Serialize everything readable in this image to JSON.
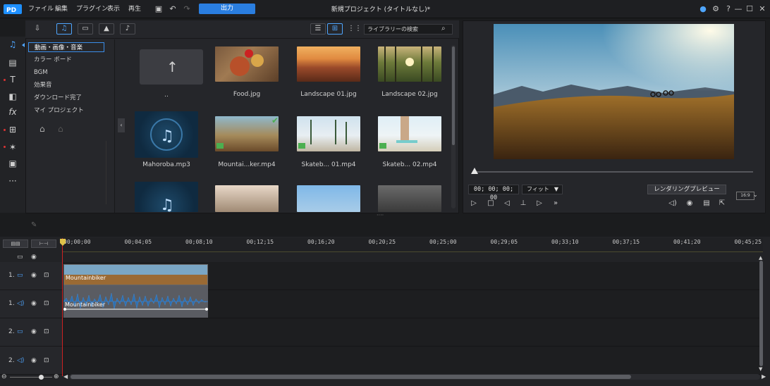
{
  "menu": {
    "file": "ファイル",
    "edit": "編集",
    "plugin": "プラグイン",
    "view": "表示",
    "play": "再生",
    "export": "出力"
  },
  "project_title": "新規プロジェクト (タイトルなし)*",
  "library": {
    "search_placeholder": "ライブラリーの検索",
    "categories": [
      "動画・画像・音楽",
      "カラー ボード",
      "BGM",
      "効果音",
      "ダウンロード完了",
      "マイ プロジェクト"
    ],
    "items": [
      {
        "label": "..",
        "kind": "up-folder"
      },
      {
        "label": "Food.jpg",
        "kind": "image"
      },
      {
        "label": "Landscape 01.jpg",
        "kind": "image"
      },
      {
        "label": "Landscape 02.jpg",
        "kind": "image"
      },
      {
        "label": "Mahoroba.mp3",
        "kind": "audio"
      },
      {
        "label": "Mountai...ker.mp4",
        "kind": "video"
      },
      {
        "label": "Skateb... 01.mp4",
        "kind": "video"
      },
      {
        "label": "Skateb... 02.mp4",
        "kind": "video"
      }
    ]
  },
  "preview": {
    "timecode": "00; 00; 00; 00",
    "fit": "フィット",
    "render_preview": "レンダリングプレビュー",
    "aspect": "16:9"
  },
  "timeline": {
    "ruler": [
      "00;00;00",
      "00;04;05",
      "00;08;10",
      "00;12;15",
      "00;16;20",
      "00;20;25",
      "00;25;00",
      "00;29;05",
      "00;33;10",
      "00;37;15",
      "00;41;20",
      "00;45;25"
    ],
    "tracks": [
      {
        "num": "1.",
        "type": "video",
        "clip": "Mountainbiker"
      },
      {
        "num": "1.",
        "type": "audio",
        "clip": "Mountainbiker"
      },
      {
        "num": "2.",
        "type": "video",
        "clip": ""
      },
      {
        "num": "2.",
        "type": "audio",
        "clip": ""
      }
    ]
  }
}
